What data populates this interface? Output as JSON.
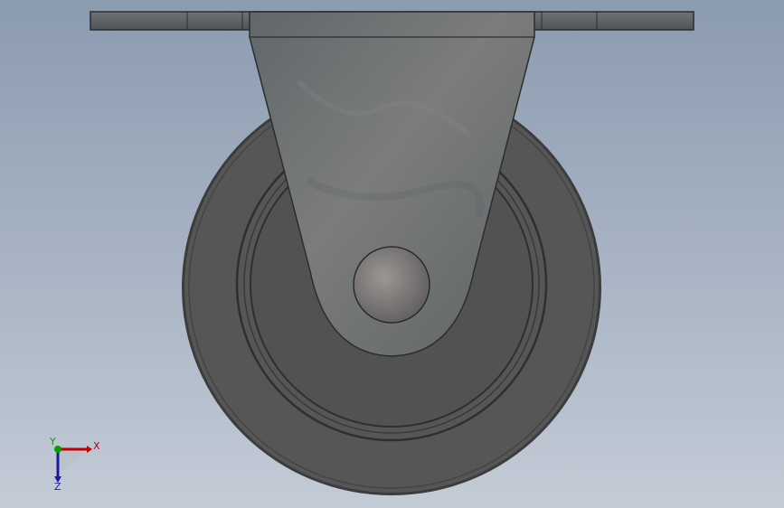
{
  "viewport": {
    "background_top": "#8b9bb0",
    "background_bottom": "#c3cbd6"
  },
  "model": {
    "name": "rigid-caster",
    "parts": [
      "mounting-plate",
      "fork-bracket",
      "wheel",
      "axle"
    ],
    "colors": {
      "plate": "#5e6266",
      "bracket": "#6a6d6d",
      "wheel_tire": "#555555",
      "wheel_hub": "#4f4f4f",
      "axle": "#7a7a7a"
    }
  },
  "triad": {
    "x_label": "X",
    "y_label": "Y",
    "z_label": "Z",
    "x_color": "#c00000",
    "y_color": "#00a000",
    "z_color": "#1a1aa0"
  }
}
